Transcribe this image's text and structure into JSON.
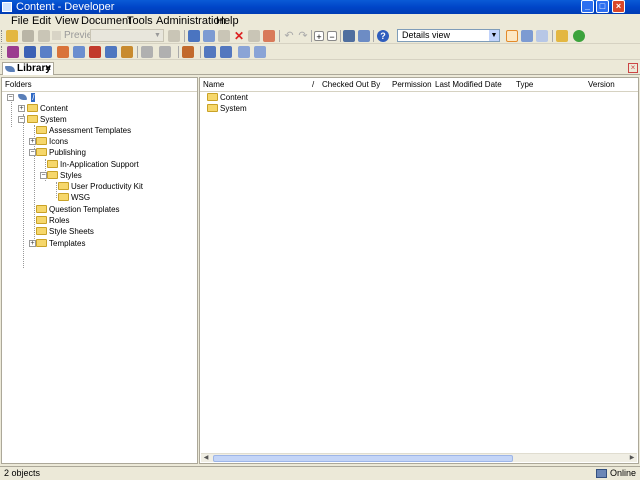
{
  "window": {
    "title": "Content - Developer"
  },
  "menu": [
    "File",
    "Edit",
    "View",
    "Document",
    "Tools",
    "Administration",
    "Help"
  ],
  "toolbar": {
    "preview_label": "Preview",
    "view_mode": "Details view"
  },
  "tab": {
    "label": "Library"
  },
  "folders_pane": {
    "header": "Folders",
    "root": "/",
    "tree": [
      {
        "label": "Content"
      },
      {
        "label": "System"
      },
      {
        "label": "Assessment Templates"
      },
      {
        "label": "Icons"
      },
      {
        "label": "Publishing"
      },
      {
        "label": "In-Application Support"
      },
      {
        "label": "Styles"
      },
      {
        "label": "User Productivity Kit"
      },
      {
        "label": "WSG"
      },
      {
        "label": "Question Templates"
      },
      {
        "label": "Roles"
      },
      {
        "label": "Style Sheets"
      },
      {
        "label": "Templates"
      }
    ]
  },
  "details": {
    "columns": [
      "Name",
      "/",
      "Checked Out By",
      "Permission",
      "Last Modified Date",
      "Type",
      "Version"
    ],
    "rows": [
      {
        "name": "Content"
      },
      {
        "name": "System"
      }
    ]
  },
  "status": {
    "count": "2 objects",
    "connection": "Online"
  }
}
